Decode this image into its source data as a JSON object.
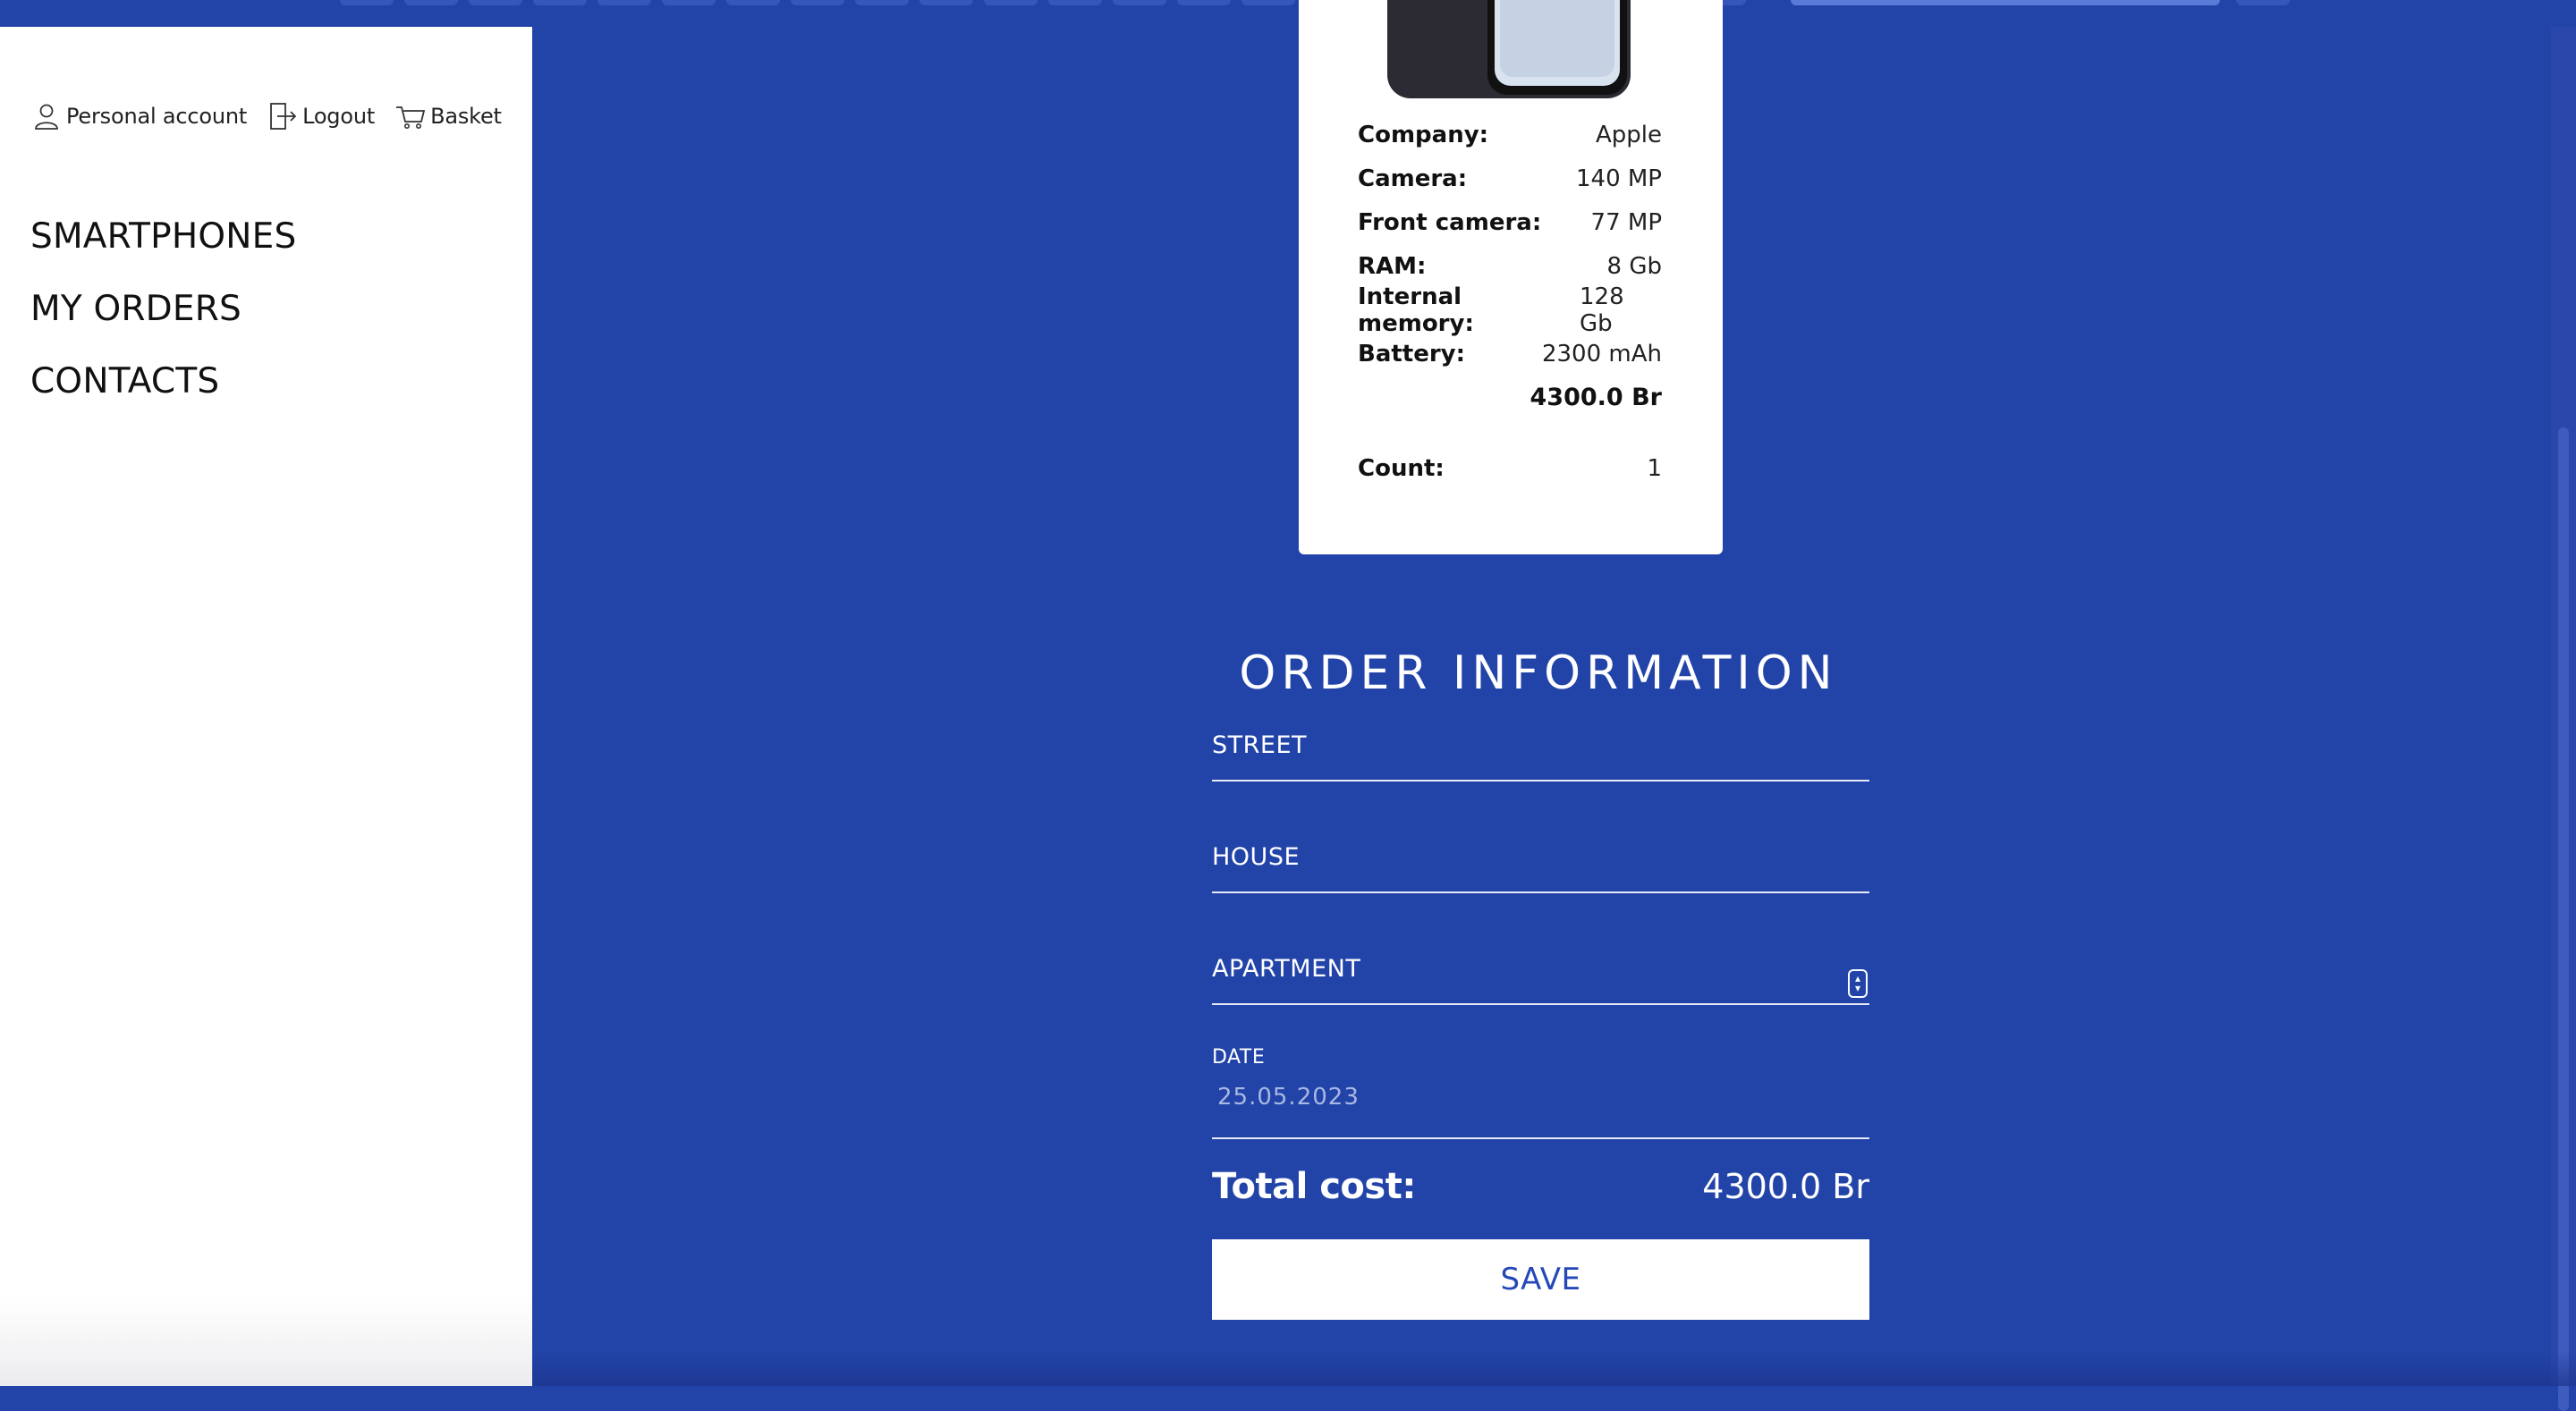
{
  "header": {
    "personal_account_label": "Personal account",
    "logout_label": "Logout",
    "basket_label": "Basket"
  },
  "nav": {
    "items": [
      {
        "label": "SMARTPHONES"
      },
      {
        "label": "MY ORDERS"
      },
      {
        "label": "CONTACTS"
      }
    ]
  },
  "product": {
    "specs": [
      {
        "key": "Company:",
        "value": "Apple"
      },
      {
        "key": "Camera:",
        "value": "140 MP"
      },
      {
        "key": "Front camera:",
        "value": "77 MP"
      },
      {
        "key": "RAM:",
        "value": "8 Gb"
      },
      {
        "key": "Internal memory:",
        "value": "128 Gb"
      },
      {
        "key": "Battery:",
        "value": "2300 mAh"
      }
    ],
    "price": "4300.0 Br",
    "count_label": "Count:",
    "count_value": "1"
  },
  "order": {
    "title": "ORDER INFORMATION",
    "street_label": "STREET",
    "house_label": "HOUSE",
    "apartment_label": "APARTMENT",
    "date_label": "DATE",
    "date_value": "25.05.2023",
    "total_label": "Total cost:",
    "total_value": "4300.0 Br",
    "save_label": "SAVE"
  },
  "colors": {
    "background": "#2244a8",
    "sidebar": "#ffffff",
    "accent": "#2448b8"
  },
  "icons": [
    "user-icon",
    "logout-icon",
    "cart-icon",
    "spinner-icon"
  ]
}
